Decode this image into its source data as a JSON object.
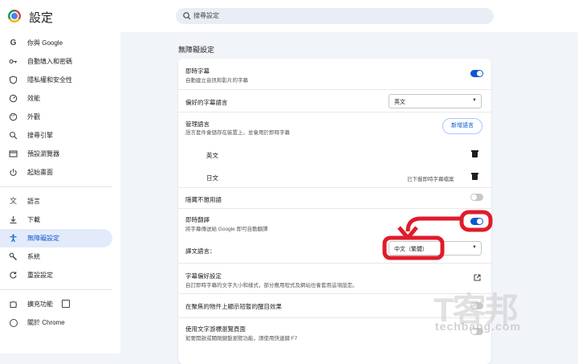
{
  "app": {
    "title": "設定"
  },
  "search": {
    "placeholder": "搜尋設定"
  },
  "sidebar": {
    "items": [
      {
        "label": "你與 Google",
        "icon": "google-icon"
      },
      {
        "label": "自動填入和密碼",
        "icon": "key-icon"
      },
      {
        "label": "隱私權和安全性",
        "icon": "shield-icon"
      },
      {
        "label": "效能",
        "icon": "speedometer-icon"
      },
      {
        "label": "外觀",
        "icon": "palette-icon"
      },
      {
        "label": "搜尋引擎",
        "icon": "search-icon"
      },
      {
        "label": "預設瀏覽器",
        "icon": "browser-icon"
      },
      {
        "label": "起始畫面",
        "icon": "power-icon"
      },
      {
        "label": "語言",
        "icon": "translate-icon"
      },
      {
        "label": "下載",
        "icon": "download-icon"
      },
      {
        "label": "無障礙設定",
        "icon": "accessibility-icon",
        "active": true
      },
      {
        "label": "系統",
        "icon": "wrench-icon"
      },
      {
        "label": "重設設定",
        "icon": "reset-icon"
      }
    ],
    "extensions_label": "擴充功能",
    "about_label": "關於 Chrome"
  },
  "main": {
    "section_title": "無障礙設定",
    "live_caption": {
      "title": "即時字幕",
      "subtitle": "自動建立音訊和影片的字幕",
      "enabled": true
    },
    "preferred_language": {
      "label": "偏好的字幕語言",
      "value": "英文"
    },
    "manage_languages": {
      "title": "管理語言",
      "subtitle": "語言套件會儲存在裝置上，並會用於即時字幕",
      "button": "新增語言"
    },
    "languages": [
      {
        "name": "英文",
        "status": ""
      },
      {
        "name": "日文",
        "status": "已下載即時字幕檔案"
      }
    ],
    "hide_profanity": {
      "label": "隱藏不雅用語",
      "enabled": false
    },
    "live_translate": {
      "title": "即時翻譯",
      "subtitle": "將字幕傳送給 Google 即可自動翻譯",
      "enabled": true
    },
    "translate_language": {
      "label": "譯文語言：",
      "value": "中文（繁體）"
    },
    "caption_prefs": {
      "title": "字幕偏好設定",
      "subtitle": "自訂即時字幕的文字大小和樣式，部分應用程式及網站也會套用這項設定。"
    },
    "focus_highlight": {
      "label": "在聚焦的物件上顯示短暫的醒目效果",
      "enabled": false
    },
    "caret_browsing": {
      "title": "使用文字游標瀏覽頁面",
      "subtitle": "如要開啟或關閉鍵盤瀏覽功能，請使用快速鍵 F7"
    }
  },
  "watermark": {
    "main": "T客邦",
    "sub": "techbang.com"
  },
  "colors": {
    "accent": "#0b57d0",
    "annotation": "#e01b2b"
  }
}
